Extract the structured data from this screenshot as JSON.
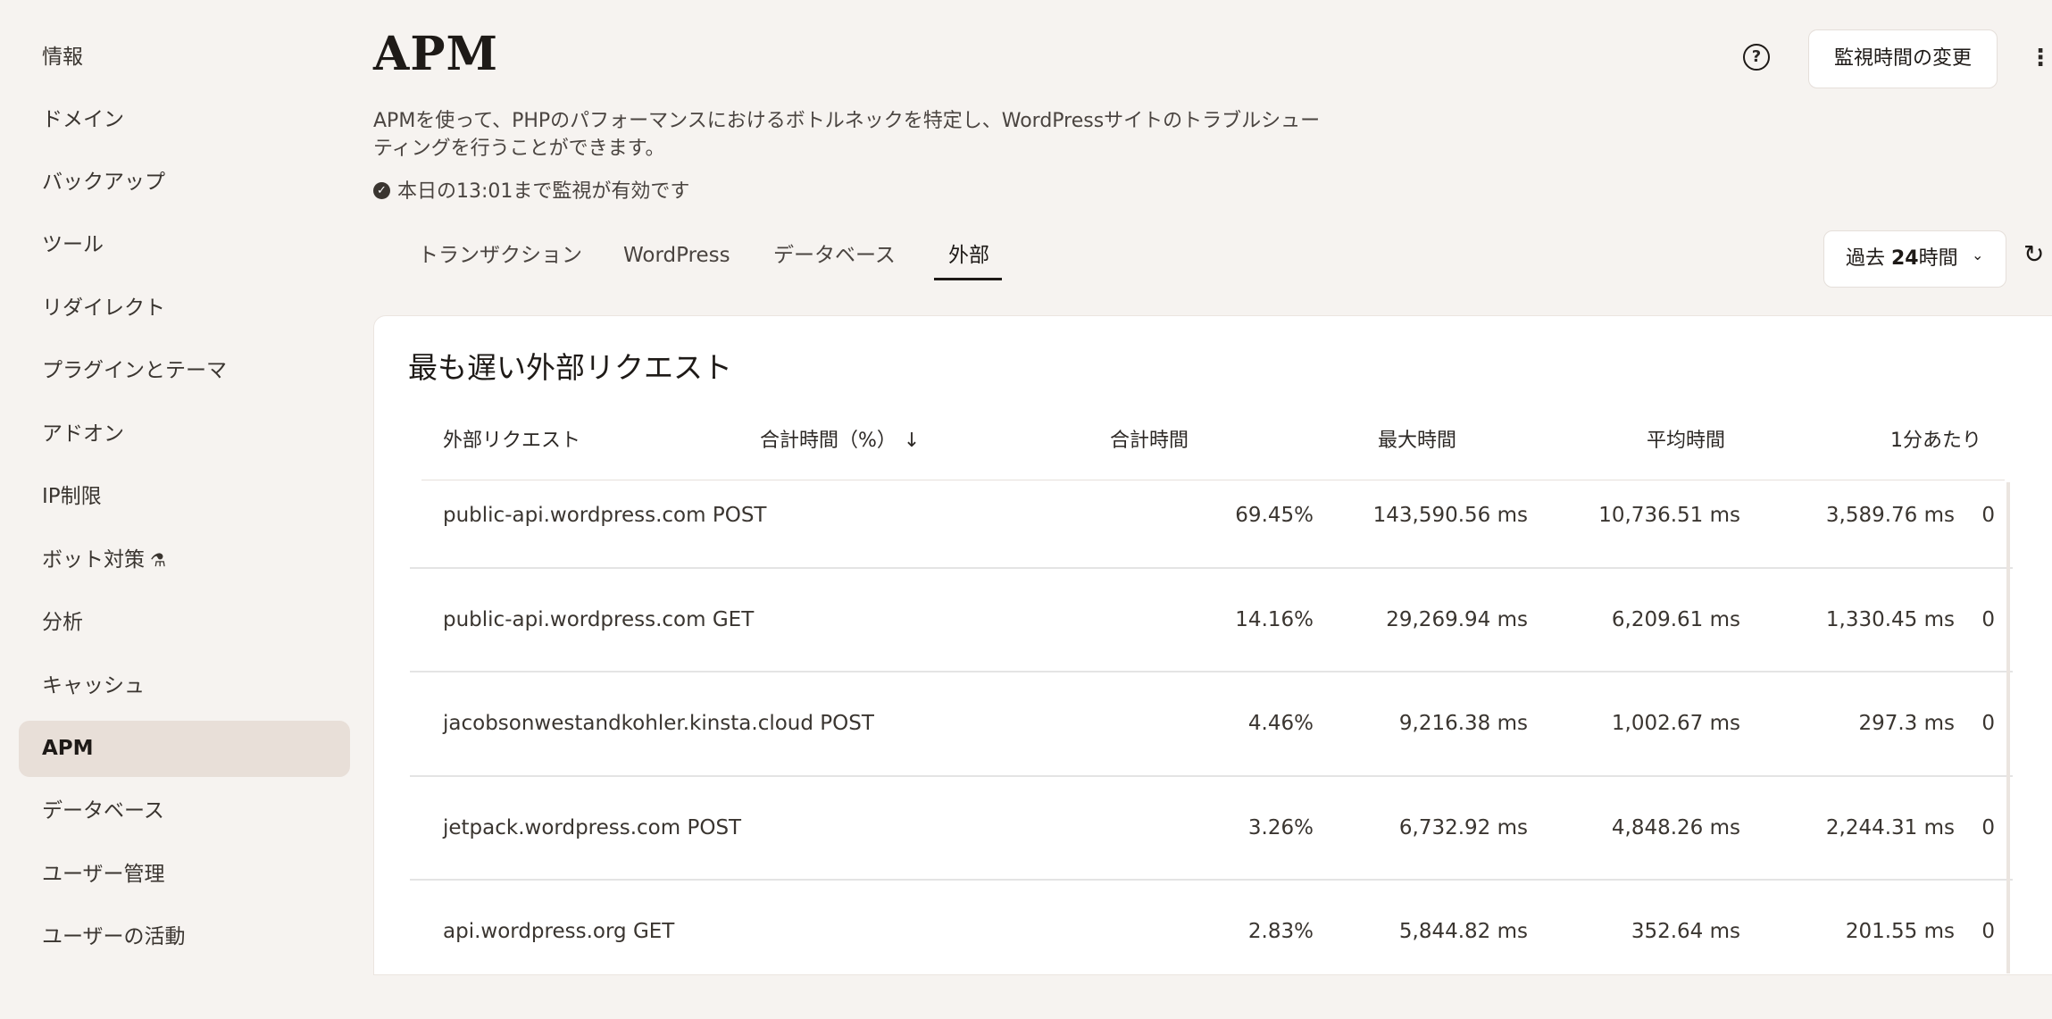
{
  "sidebar": {
    "items": [
      {
        "label": "情報"
      },
      {
        "label": "ドメイン"
      },
      {
        "label": "バックアップ"
      },
      {
        "label": "ツール"
      },
      {
        "label": "リダイレクト"
      },
      {
        "label": "プラグインとテーマ"
      },
      {
        "label": "アドオン"
      },
      {
        "label": "IP制限"
      },
      {
        "label": "ボット対策",
        "icon": "flask-icon"
      },
      {
        "label": "分析"
      },
      {
        "label": "キャッシュ"
      },
      {
        "label": "APM",
        "active": true
      },
      {
        "label": "データベース"
      },
      {
        "label": "ユーザー管理"
      },
      {
        "label": "ユーザーの活動"
      }
    ]
  },
  "header": {
    "title": "APM",
    "help_icon": "question-circle-icon",
    "monitor_button": "監視時間の変更",
    "more_icon": "vertical-ellipsis-icon",
    "description": "APMを使って、PHPのパフォーマンスにおけるボトルネックを特定し、WordPressサイトのトラブルシューティングを行うことができます。",
    "status_text": "本日の13:01まで監視が有効です"
  },
  "tabs": [
    {
      "label": "トランザクション"
    },
    {
      "label": "WordPress"
    },
    {
      "label": "データベース"
    },
    {
      "label": "外部",
      "active": true
    }
  ],
  "range": {
    "prefix": "過去 ",
    "value": "24",
    "suffix": "時間"
  },
  "card": {
    "title": "最も遅い外部リクエスト",
    "columns": {
      "request": "外部リクエスト",
      "total_pct": "合計時間（%）",
      "sort_icon": "arrow-down-icon",
      "total_time": "合計時間",
      "max_time": "最大時間",
      "avg_time": "平均時間",
      "per_min": "1分あたり"
    },
    "rows": [
      {
        "request": "public-api.wordpress.com POST",
        "pct": "69.45%",
        "total": "143,590.56 ms",
        "max": "10,736.51 ms",
        "avg": "3,589.76 ms",
        "per_min": "0"
      },
      {
        "request": "public-api.wordpress.com GET",
        "pct": "14.16%",
        "total": "29,269.94 ms",
        "max": "6,209.61 ms",
        "avg": "1,330.45 ms",
        "per_min": "0"
      },
      {
        "request": "jacobsonwestandkohler.kinsta.cloud POST",
        "pct": "4.46%",
        "total": "9,216.38 ms",
        "max": "1,002.67 ms",
        "avg": "297.3 ms",
        "per_min": "0"
      },
      {
        "request": "jetpack.wordpress.com POST",
        "pct": "3.26%",
        "total": "6,732.92 ms",
        "max": "4,848.26 ms",
        "avg": "2,244.31 ms",
        "per_min": "0"
      },
      {
        "request": "api.wordpress.org GET",
        "pct": "2.83%",
        "total": "5,844.82 ms",
        "max": "352.64 ms",
        "avg": "201.55 ms",
        "per_min": "0"
      }
    ]
  }
}
